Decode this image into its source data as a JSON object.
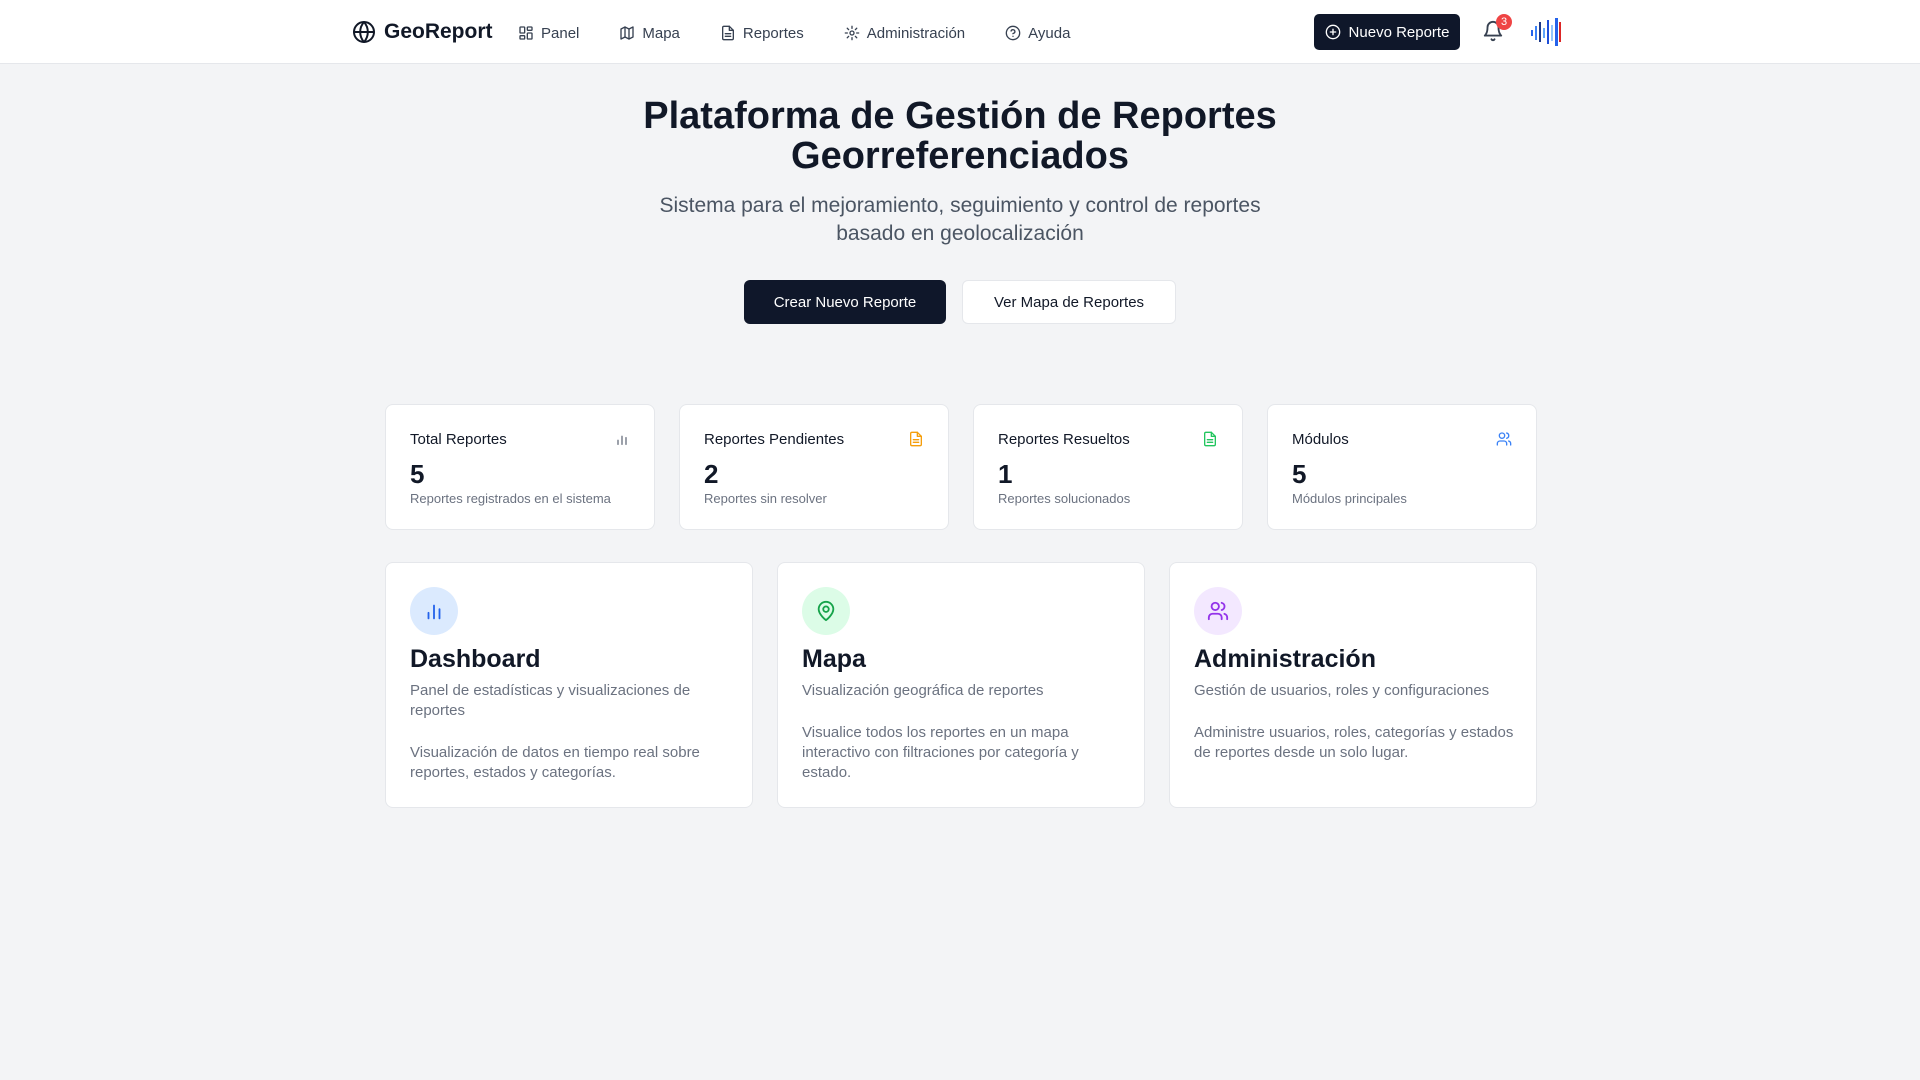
{
  "header": {
    "brand": "GeoReport",
    "nav": [
      {
        "label": "Panel",
        "icon": "layout-grid-icon"
      },
      {
        "label": "Mapa",
        "icon": "map-icon"
      },
      {
        "label": "Reportes",
        "icon": "file-text-icon"
      },
      {
        "label": "Administración",
        "icon": "gear-icon"
      },
      {
        "label": "Ayuda",
        "icon": "help-circle-icon"
      }
    ],
    "new_report_label": "Nuevo Reporte",
    "notification_count": "3"
  },
  "hero": {
    "title_line1": "Plataforma de Gestión de Reportes",
    "title_line2": "Georreferenciados",
    "subtitle": "Sistema para el mejoramiento, seguimiento y control de reportes basado en geolocalización",
    "primary_button": "Crear Nuevo Reporte",
    "secondary_button": "Ver Mapa de Reportes"
  },
  "stats": [
    {
      "title": "Total Reportes",
      "value": "5",
      "description": "Reportes registrados en el sistema",
      "icon": "bar-chart-icon",
      "color": "#6b7280"
    },
    {
      "title": "Reportes Pendientes",
      "value": "2",
      "description": "Reportes sin resolver",
      "icon": "file-icon",
      "color": "#f59e0b"
    },
    {
      "title": "Reportes Resueltos",
      "value": "1",
      "description": "Reportes solucionados",
      "icon": "file-check-icon",
      "color": "#22c55e"
    },
    {
      "title": "Módulos",
      "value": "5",
      "description": "Módulos principales",
      "icon": "users-icon",
      "color": "#3b82f6"
    }
  ],
  "features": [
    {
      "title": "Dashboard",
      "subtitle": "Panel de estadísticas y visualizaciones de reportes",
      "description": "Visualización de datos en tiempo real sobre reportes, estados y categorías.",
      "icon": "bar-chart-icon",
      "color": "#2563eb",
      "bg": "#dbeafe"
    },
    {
      "title": "Mapa",
      "subtitle": "Visualización geográfica de reportes",
      "description": "Visualice todos los reportes en un mapa interactivo con filtraciones por categoría y estado.",
      "icon": "map-pin-icon",
      "color": "#16a34a",
      "bg": "#dcfce7"
    },
    {
      "title": "Administración",
      "subtitle": "Gestión de usuarios, roles y configuraciones",
      "description": "Administre usuarios, roles, categorías y estados de reportes desde un solo lugar.",
      "icon": "users-icon",
      "color": "#9333ea",
      "bg": "#f3e8ff"
    }
  ]
}
